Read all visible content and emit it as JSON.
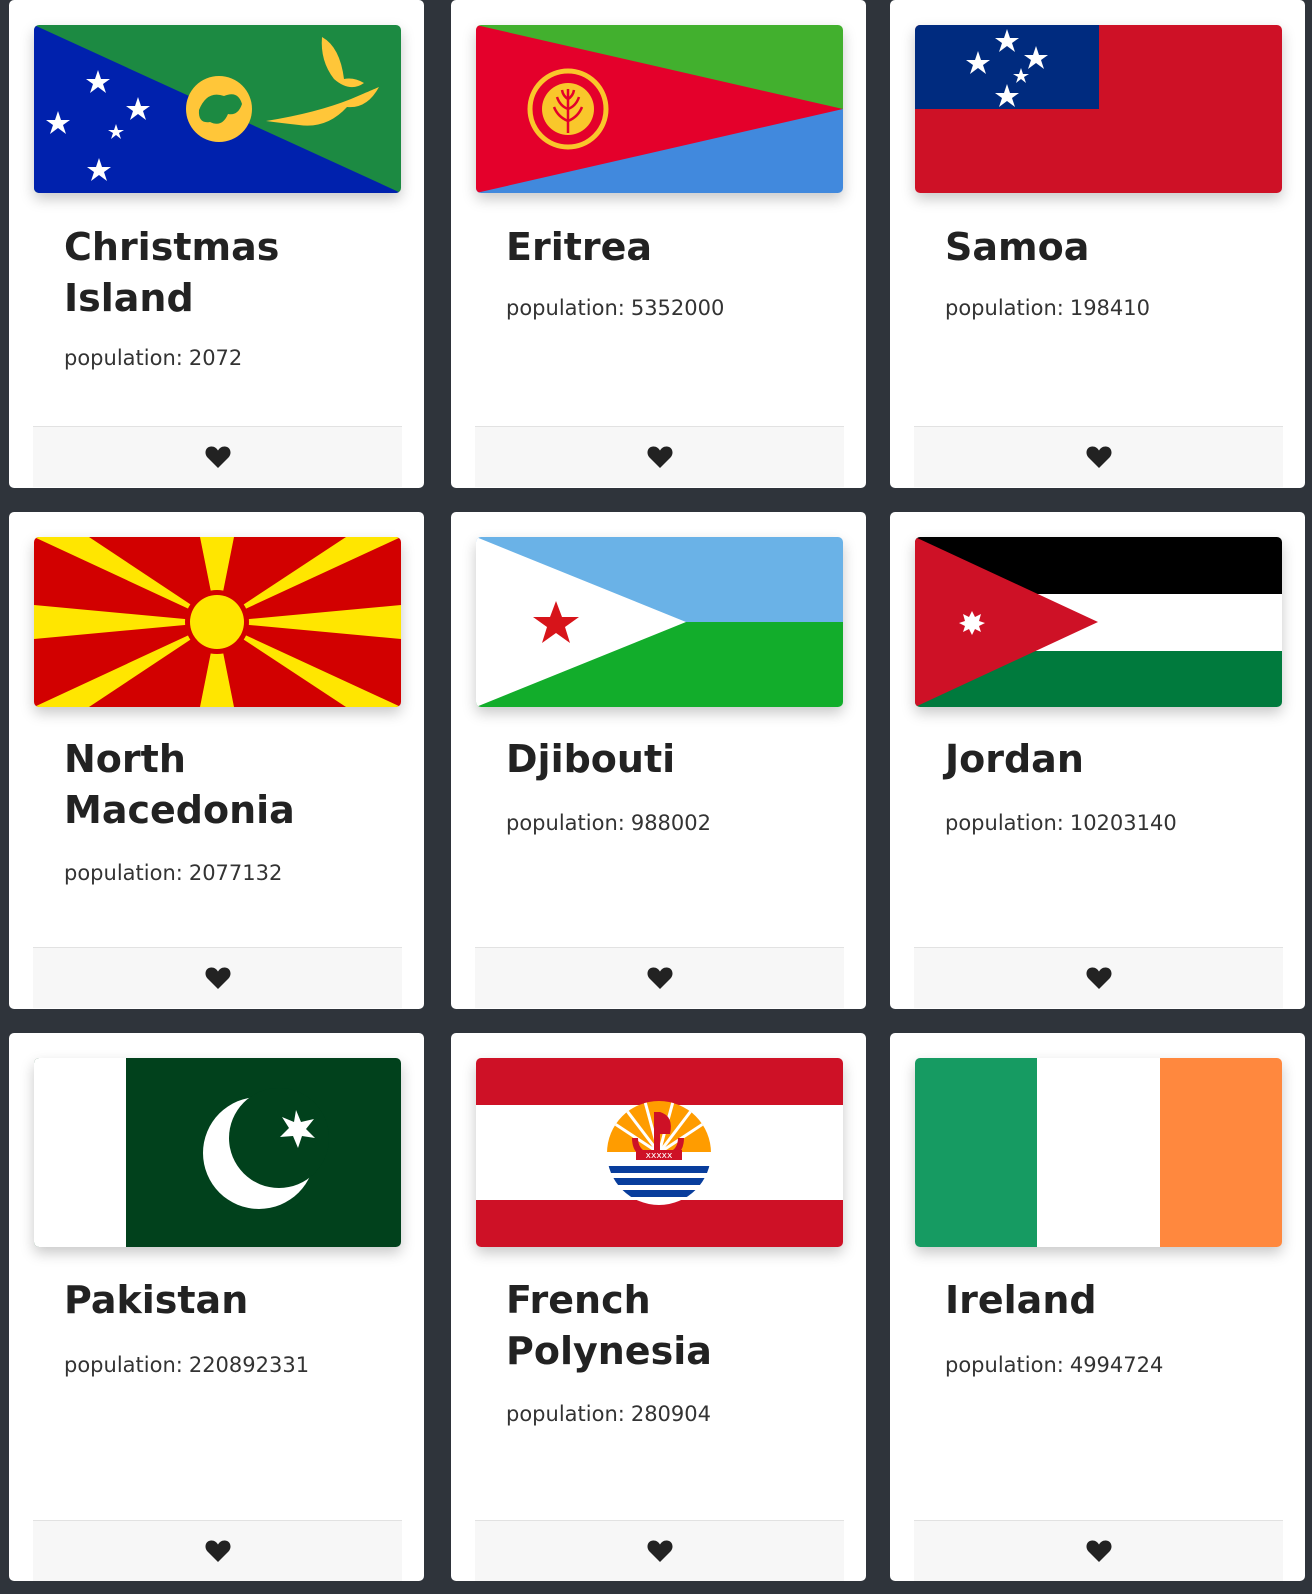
{
  "population_label": "population:",
  "favorite_icon": "heart-icon",
  "cards": [
    {
      "name": "Christmas Island",
      "population": "2072"
    },
    {
      "name": "Eritrea",
      "population": "5352000"
    },
    {
      "name": "Samoa",
      "population": "198410"
    },
    {
      "name": "North Macedonia",
      "population": "2077132"
    },
    {
      "name": "Djibouti",
      "population": "988002"
    },
    {
      "name": "Jordan",
      "population": "10203140"
    },
    {
      "name": "Pakistan",
      "population": "220892331"
    },
    {
      "name": "French Polynesia",
      "population": "280904"
    },
    {
      "name": "Ireland",
      "population": "4994724"
    }
  ]
}
